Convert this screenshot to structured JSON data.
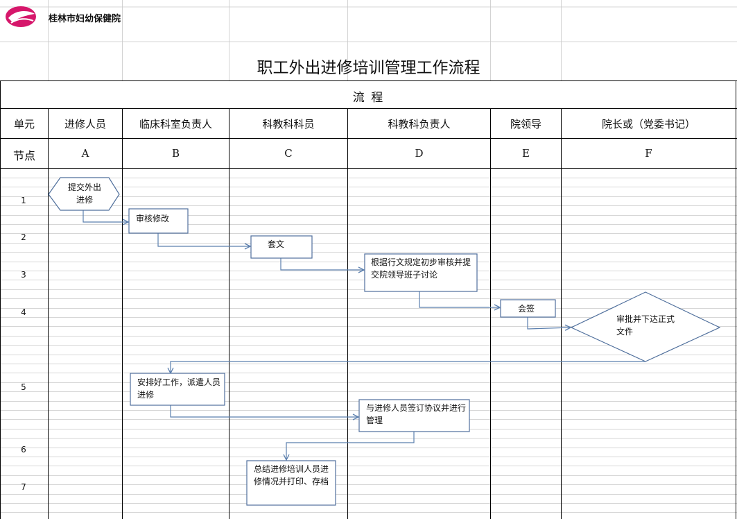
{
  "header": {
    "organization": "桂林市妇幼保健院"
  },
  "diagram": {
    "title": "职工外出进修培训管理工作流程",
    "section_label": "流  程",
    "row_labels": {
      "unit": "单元",
      "node": "节点"
    },
    "columns": [
      {
        "role": "进修人员",
        "code": "A"
      },
      {
        "role": "临床科室负责人",
        "code": "B"
      },
      {
        "role": "科教科科员",
        "code": "C"
      },
      {
        "role": "科教科负责人",
        "code": "D"
      },
      {
        "role": "院领导",
        "code": "E"
      },
      {
        "role": "院长或（党委书记）",
        "code": "F"
      }
    ],
    "steps": [
      "1",
      "2",
      "3",
      "4",
      "5",
      "6",
      "7"
    ],
    "nodes": {
      "submit": "提交外出进修",
      "review": "审核修改",
      "draft": "套文",
      "preliminary": "根据行文规定初步审核并提交院领导班子讨论",
      "countersign": "会签",
      "approve": "审批并下达正式文件",
      "arrange": "安排好工作，派遣人员进修",
      "agreement": "与进修人员签订协议并进行管理",
      "summary": "总结进修培训人员进修情况并打印、存档"
    },
    "colors": {
      "line": "#5b7fae",
      "logo": "#d6176b",
      "grid": "#c8c8c8",
      "border": "#000000"
    }
  }
}
